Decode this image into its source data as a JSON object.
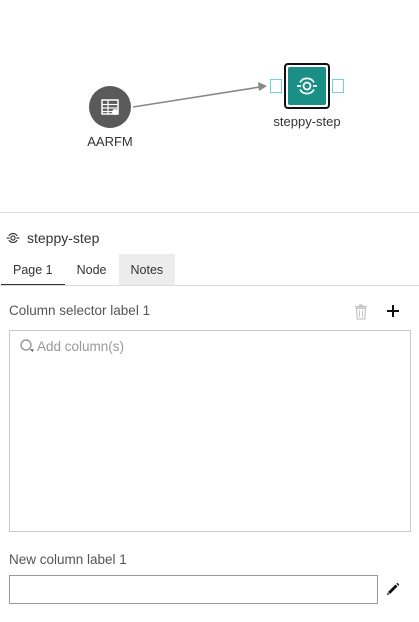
{
  "canvas": {
    "nodes": [
      {
        "label": "AARFM",
        "icon": "dataset-table-icon",
        "color": "#5a5a5a"
      },
      {
        "label": "steppy-step",
        "icon": "recipe-step-icon",
        "color": "#1a8f86"
      }
    ],
    "port_color": "#6fd3d8",
    "edge_color": "#888888"
  },
  "panel": {
    "title": "steppy-step",
    "title_icon": "recipe-step-icon"
  },
  "tabs": [
    {
      "label": "Page 1",
      "state": "active"
    },
    {
      "label": "Node",
      "state": "normal"
    },
    {
      "label": "Notes",
      "state": "hover"
    }
  ],
  "column_selector": {
    "label": "Column selector label 1",
    "placeholder": "Add column(s)"
  },
  "new_column": {
    "label": "New column label 1",
    "value": ""
  }
}
